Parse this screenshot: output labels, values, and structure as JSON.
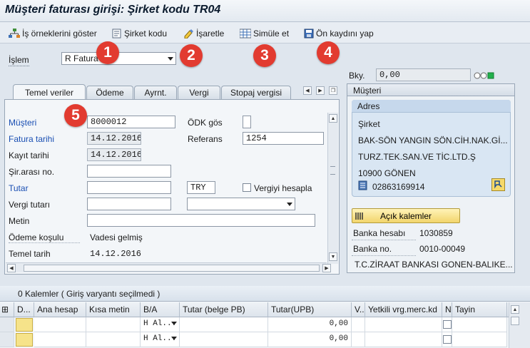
{
  "window": {
    "title": "Müşteri faturası girişi: Şirket kodu TR04"
  },
  "toolbar": {
    "examples": "İş örneklerini göster",
    "company_code": "Şirket kodu",
    "mark": "İşaretle",
    "simulate": "Simüle et",
    "park": "Ön kaydını yap"
  },
  "markers": [
    "1",
    "2",
    "3",
    "4",
    "5"
  ],
  "transaction": {
    "label": "İşlem",
    "value": "R Fatura"
  },
  "balance": {
    "label": "Bky.",
    "value": "0,00"
  },
  "tabs": [
    "Temel veriler",
    "Ödeme",
    "Ayrnt.",
    "Vergi",
    "Stopaj vergisi"
  ],
  "form": {
    "customer_label": "Müşteri",
    "customer_value": "8000012",
    "invoice_date_label": "Fatura tarihi",
    "invoice_date_value": "14.12.2016",
    "posting_date_label": "Kayıt tarihi",
    "posting_date_value": "14.12.2016",
    "cross_company_label": "Şir.arası no.",
    "cross_company_value": "",
    "amount_label": "Tutar",
    "amount_value": "",
    "currency_value": "TRY",
    "calc_tax_label": "Vergiyi hesapla",
    "tax_amount_label": "Vergi tutarı",
    "tax_amount_value": "",
    "text_label": "Metin",
    "text_value": "",
    "payment_terms_label": "Ödeme koşulu",
    "payment_terms_value": "Vadesi gelmiş",
    "baseline_date_label": "Temel tarih",
    "baseline_date_value": "14.12.2016",
    "odk_label": "ÖDK gös",
    "reference_label": "Referans",
    "reference_value": "1254"
  },
  "customer_panel": {
    "title": "Müşteri",
    "address_title": "Adres",
    "lines": [
      "Şirket",
      "BAK-SÖN YANGIN SÖN.CİH.NAK.Gİ...",
      "TURZ.TEK.SAN.VE TİC.LTD.Ş",
      "10900 GÖNEN"
    ],
    "phone": "02863169914",
    "open_items": "Açık kalemler",
    "bank_account_label": "Banka hesabı",
    "bank_account_value": "1030859",
    "bank_no_label": "Banka no.",
    "bank_no_value": "0010-00049",
    "bank_name": "T.C.ZİRAAT BANKASI GONEN-BALIKE..."
  },
  "items": {
    "title": "0 Kalemler ( Giriş varyantı seçilmedi )",
    "columns": [
      "D...",
      "Ana hesap",
      "Kısa metin",
      "B/A",
      "Tutar (belge PB)",
      "Tutar(UPB)",
      "V..",
      "Yetkili vrg.merc.kd",
      "N",
      "Tayin"
    ],
    "rows": [
      {
        "ba": "H Al...",
        "upb": "0,00"
      },
      {
        "ba": "H Al...",
        "upb": "0,00"
      }
    ]
  },
  "colors": {
    "marker": "#e23b30",
    "link_label": "#1a4fb3",
    "status_green": "#22b14c"
  }
}
